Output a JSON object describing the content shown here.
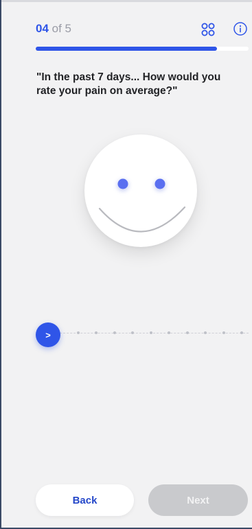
{
  "header": {
    "current_step": "04",
    "of_text": "of 5",
    "grid_icon": "grid-dots-icon",
    "info_icon": "info-icon"
  },
  "progress": {
    "fraction": 0.85,
    "accent_color": "#2f55e8"
  },
  "question": {
    "text": "\"In the past 7 days... How would you rate your pain on average?\""
  },
  "face": {
    "icon": "smiley-face-icon",
    "eye_color": "#5a6ff0"
  },
  "slider": {
    "thumb_label": ">",
    "steps": 11,
    "selected_index": 0
  },
  "footer": {
    "back_label": "Back",
    "next_label": "Next",
    "next_disabled": true
  }
}
